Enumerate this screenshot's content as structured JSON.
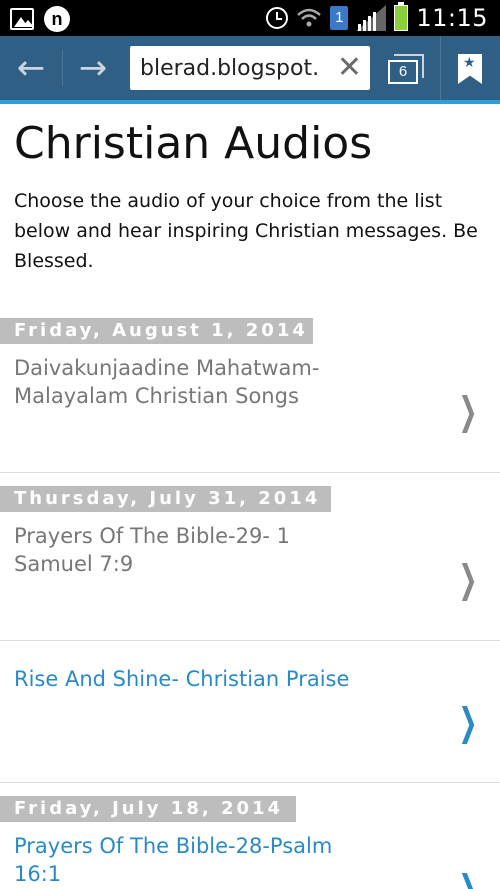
{
  "status_bar": {
    "time": "11:15",
    "n_icon_letter": "n",
    "badge_number": "1",
    "icons": [
      "gallery-icon",
      "n-app-icon",
      "alarm-icon",
      "wifi-icon",
      "sim-badge-icon",
      "signal-icon",
      "battery-icon"
    ],
    "battery_color": "#8ccf3c"
  },
  "browser": {
    "url": "blerad.blogspot.",
    "tab_count": "6",
    "back_icon": "←",
    "forward_icon": "→",
    "clear_icon": "✕",
    "bookmark_star": "★",
    "toolbar_color": "#2f5f84",
    "accent_color": "#2f9fd6"
  },
  "page": {
    "title": "Christian Audios",
    "description": "Choose the audio of your choice from the list below and hear inspiring Christian messages. Be Blessed."
  },
  "posts": [
    {
      "date": "Friday, August 1, 2014",
      "title": "Daivakunjaadine Mahatwam- Malayalam Christian Songs",
      "chevron": "❯",
      "style": "gray"
    },
    {
      "date": "Thursday, July 31, 2014",
      "title": "Prayers Of The Bible-29- 1 Samuel 7:9",
      "chevron": "❯",
      "style": "gray"
    },
    {
      "date": "",
      "title": "Rise And Shine- Christian Praise",
      "chevron": "❯",
      "style": "blue"
    },
    {
      "date": "Friday, July 18, 2014",
      "title": "Prayers Of The Bible-28-Psalm 16:1",
      "chevron": "❯",
      "style": "blue"
    }
  ]
}
